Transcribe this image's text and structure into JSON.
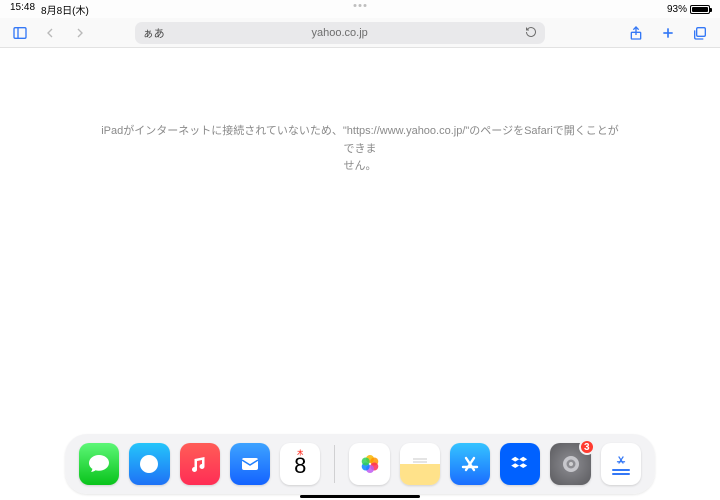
{
  "status": {
    "time": "15:48",
    "date": "8月8日(木)",
    "battery_pct": "93%"
  },
  "toolbar": {
    "aa_label": "ぁあ",
    "url": "yahoo.co.jp"
  },
  "content": {
    "error_line1": "iPadがインターネットに接続されていないため、\"https://www.yahoo.co.jp/\"のページをSafariで開くことができま",
    "error_line2": "せん。"
  },
  "dock": {
    "calendar_weekday": "木",
    "calendar_day": "8",
    "settings_badge": "3"
  }
}
